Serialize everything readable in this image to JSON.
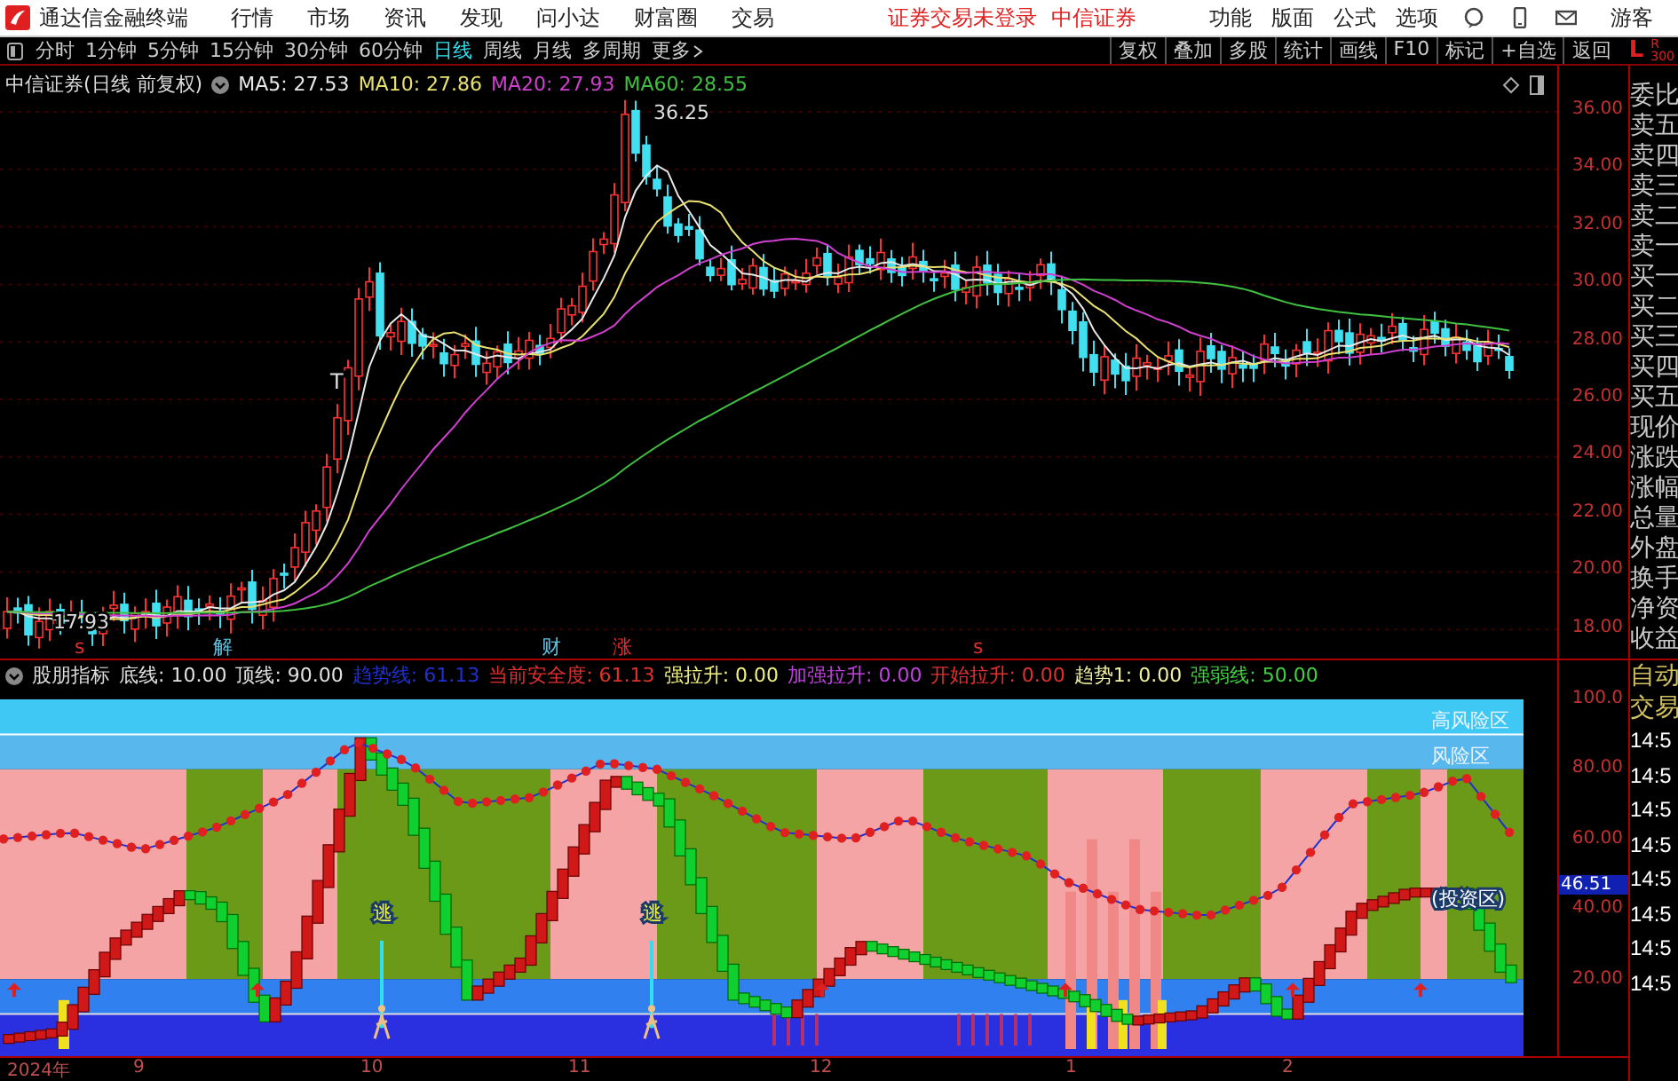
{
  "menu_bar": {
    "app_title": "通达信金融终端",
    "menus": [
      "行情",
      "市场",
      "资讯",
      "发现",
      "问小达",
      "财富圈",
      "交易"
    ],
    "login_status": "证券交易未登录",
    "broker": "中信证券",
    "tools": [
      "功能",
      "版面",
      "公式",
      "选项"
    ],
    "user": "游客"
  },
  "toolbar": {
    "periods": [
      {
        "label": "分时",
        "selected": false
      },
      {
        "label": "1分钟",
        "selected": false
      },
      {
        "label": "5分钟",
        "selected": false
      },
      {
        "label": "15分钟",
        "selected": false
      },
      {
        "label": "30分钟",
        "selected": false
      },
      {
        "label": "60分钟",
        "selected": false
      },
      {
        "label": "日线",
        "selected": true
      },
      {
        "label": "周线",
        "selected": false
      },
      {
        "label": "月线",
        "selected": false
      },
      {
        "label": "多周期",
        "selected": false
      }
    ],
    "more": "更多",
    "buttons": [
      "复权",
      "叠加",
      "多股",
      "统计",
      "画线",
      "F10",
      "标记",
      "+自选",
      "返回"
    ],
    "side_left": "L",
    "side_right": "R",
    "side_right_sub": "300"
  },
  "price_chart": {
    "title": "中信证券(日线 前复权)",
    "ma_legend": [
      {
        "label": "MA5: 27.53",
        "color": "#e8e8e8"
      },
      {
        "label": "MA10: 27.86",
        "color": "#e8e070"
      },
      {
        "label": "MA20: 27.93",
        "color": "#d040d0"
      },
      {
        "label": "MA60: 28.55",
        "color": "#40c040"
      }
    ],
    "high_label": "36.25",
    "low_label": "17.93",
    "marker": "T",
    "events": [
      {
        "label": "s",
        "color": "#e03030"
      },
      {
        "label": "解",
        "color": "#60c0e0"
      },
      {
        "label": "财",
        "color": "#60c0e0"
      },
      {
        "label": "涨",
        "color": "#e03030"
      },
      {
        "label": "s",
        "color": "#e03030"
      }
    ],
    "y_axis": [
      "36.00",
      "34.00",
      "32.00",
      "30.00",
      "28.00",
      "26.00",
      "24.00",
      "22.00",
      "20.00",
      "18.00"
    ]
  },
  "quote_panel": [
    "委比",
    "卖五",
    "卖四",
    "卖三",
    "卖二",
    "卖一",
    "买一",
    "买二",
    "买三",
    "买四",
    "买五",
    "现价",
    "涨跌",
    "涨幅",
    "总量",
    "外盘",
    "换手",
    "净资",
    "收益"
  ],
  "indicator": {
    "name": "股朋指标",
    "params": [
      {
        "label": "底线: 10.00",
        "color": "#e0e0e0"
      },
      {
        "label": "顶线: 90.00",
        "color": "#e0e0e0"
      },
      {
        "label": "趋势线: 61.13",
        "color": "#2030d0"
      },
      {
        "label": "当前安全度: 61.13",
        "color": "#e03030"
      },
      {
        "label": "强拉升: 0.00",
        "color": "#f0f080"
      },
      {
        "label": "加强拉升: 0.00",
        "color": "#c040e0"
      },
      {
        "label": "开始拉升: 0.00",
        "color": "#e03030"
      },
      {
        "label": "趋势1: 0.00",
        "color": "#f0f0a0"
      },
      {
        "label": "强弱线: 50.00",
        "color": "#40d040"
      }
    ],
    "zones": [
      "高风险区",
      "风险区",
      "(投资区)"
    ],
    "signals": [
      "逃",
      "逃"
    ],
    "y_axis": [
      "100.0",
      "80.00",
      "60.00",
      "40.00",
      "20.00"
    ],
    "current_value": "46.51"
  },
  "trade_panel": {
    "header": [
      "自动",
      "交易"
    ],
    "times": [
      "14:5",
      "14:5",
      "14:5",
      "14:5",
      "14:5",
      "14:5",
      "14:5",
      "14:5"
    ]
  },
  "time_axis": [
    "2024年",
    "9",
    "10",
    "11",
    "12",
    "1",
    "2"
  ]
}
